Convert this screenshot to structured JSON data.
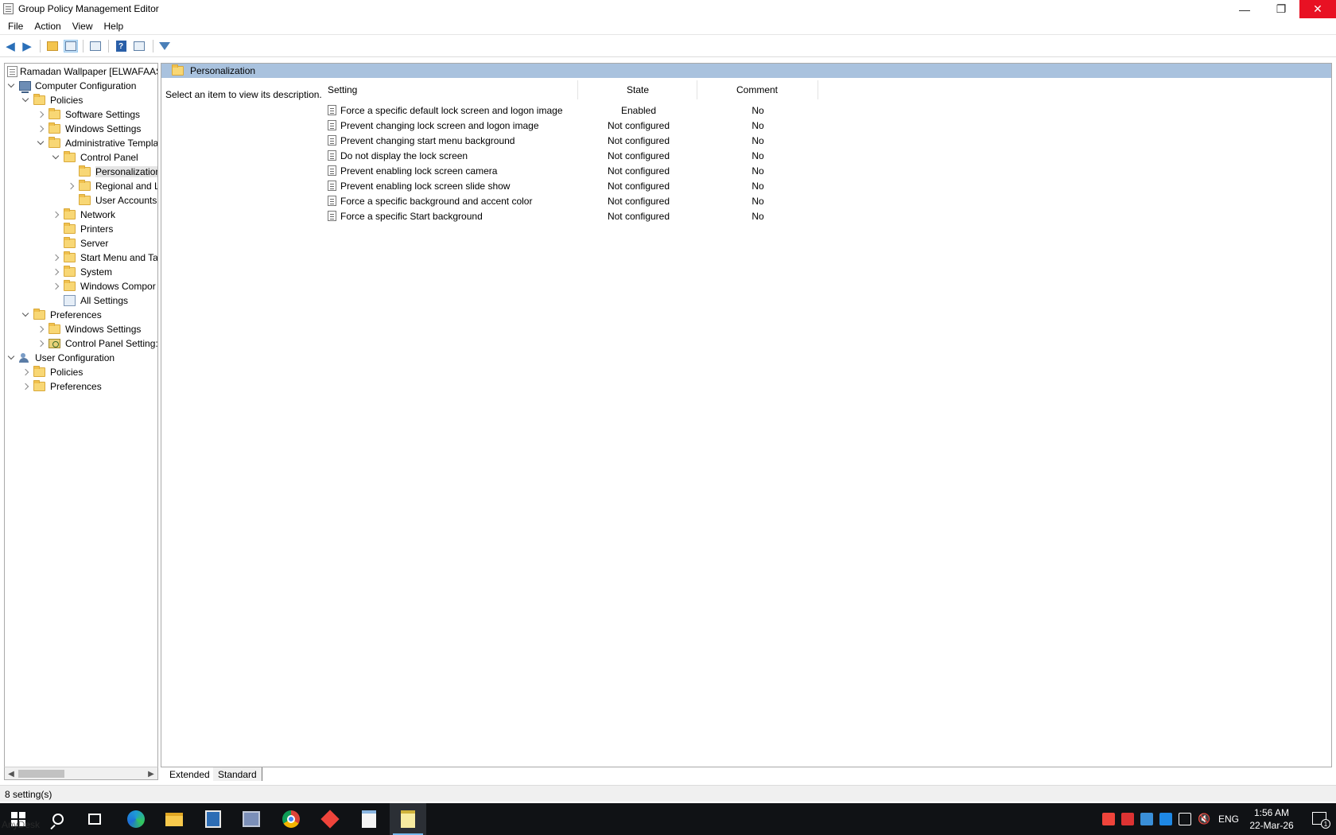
{
  "window": {
    "title": "Group Policy Management Editor",
    "minimize": "—",
    "restore": "❐",
    "close": "✕"
  },
  "menu": [
    "File",
    "Action",
    "View",
    "Help"
  ],
  "toolbar": {
    "icons": [
      "back-icon",
      "forward-icon",
      "up-folder-icon",
      "show-hide-tree-icon",
      "export-list-icon",
      "help-icon",
      "console-tree-icon",
      "filter-icon"
    ]
  },
  "tree": {
    "root": "Ramadan Wallpaper [ELWAFAAS",
    "computer_configuration": "Computer Configuration",
    "cc_policies": "Policies",
    "software_settings": "Software Settings",
    "windows_settings": "Windows Settings",
    "administrative_templates": "Administrative Templa",
    "control_panel": "Control Panel",
    "personalization": "Personalization",
    "regional": "Regional and L",
    "user_accounts": "User Accounts",
    "network": "Network",
    "printers": "Printers",
    "server": "Server",
    "start_menu": "Start Menu and Ta",
    "system": "System",
    "windows_components": "Windows Compor",
    "all_settings": "All Settings",
    "cc_preferences": "Preferences",
    "pref_windows_settings": "Windows Settings",
    "control_panel_settings": "Control Panel Setting:",
    "user_configuration": "User Configuration",
    "uc_policies": "Policies",
    "uc_preferences": "Preferences"
  },
  "content": {
    "header": "Personalization",
    "description": "Select an item to view its description.",
    "columns": {
      "setting": "Setting",
      "state": "State",
      "comment": "Comment"
    },
    "rows": [
      {
        "name": "Force a specific default lock screen and logon image",
        "state": "Enabled",
        "comment": "No"
      },
      {
        "name": "Prevent changing lock screen and logon image",
        "state": "Not configured",
        "comment": "No"
      },
      {
        "name": "Prevent changing start menu background",
        "state": "Not configured",
        "comment": "No"
      },
      {
        "name": "Do not display the lock screen",
        "state": "Not configured",
        "comment": "No"
      },
      {
        "name": "Prevent enabling lock screen camera",
        "state": "Not configured",
        "comment": "No"
      },
      {
        "name": "Prevent enabling lock screen slide show",
        "state": "Not configured",
        "comment": "No"
      },
      {
        "name": "Force a specific background and accent color",
        "state": "Not configured",
        "comment": "No"
      },
      {
        "name": "Force a specific Start background",
        "state": "Not configured",
        "comment": "No"
      }
    ]
  },
  "tabs": {
    "extended": "Extended",
    "standard": "Standard"
  },
  "status": {
    "text": "8 setting(s)"
  },
  "taskbar": {
    "lang": "ENG",
    "time": "1:56 AM",
    "date": "22-Mar-26",
    "notification_count": "1",
    "anydesk_label": "AnyDesk"
  },
  "colors": {
    "header_bg": "#a9c2de",
    "close_red": "#e81123",
    "taskbar_bg": "#101215"
  }
}
